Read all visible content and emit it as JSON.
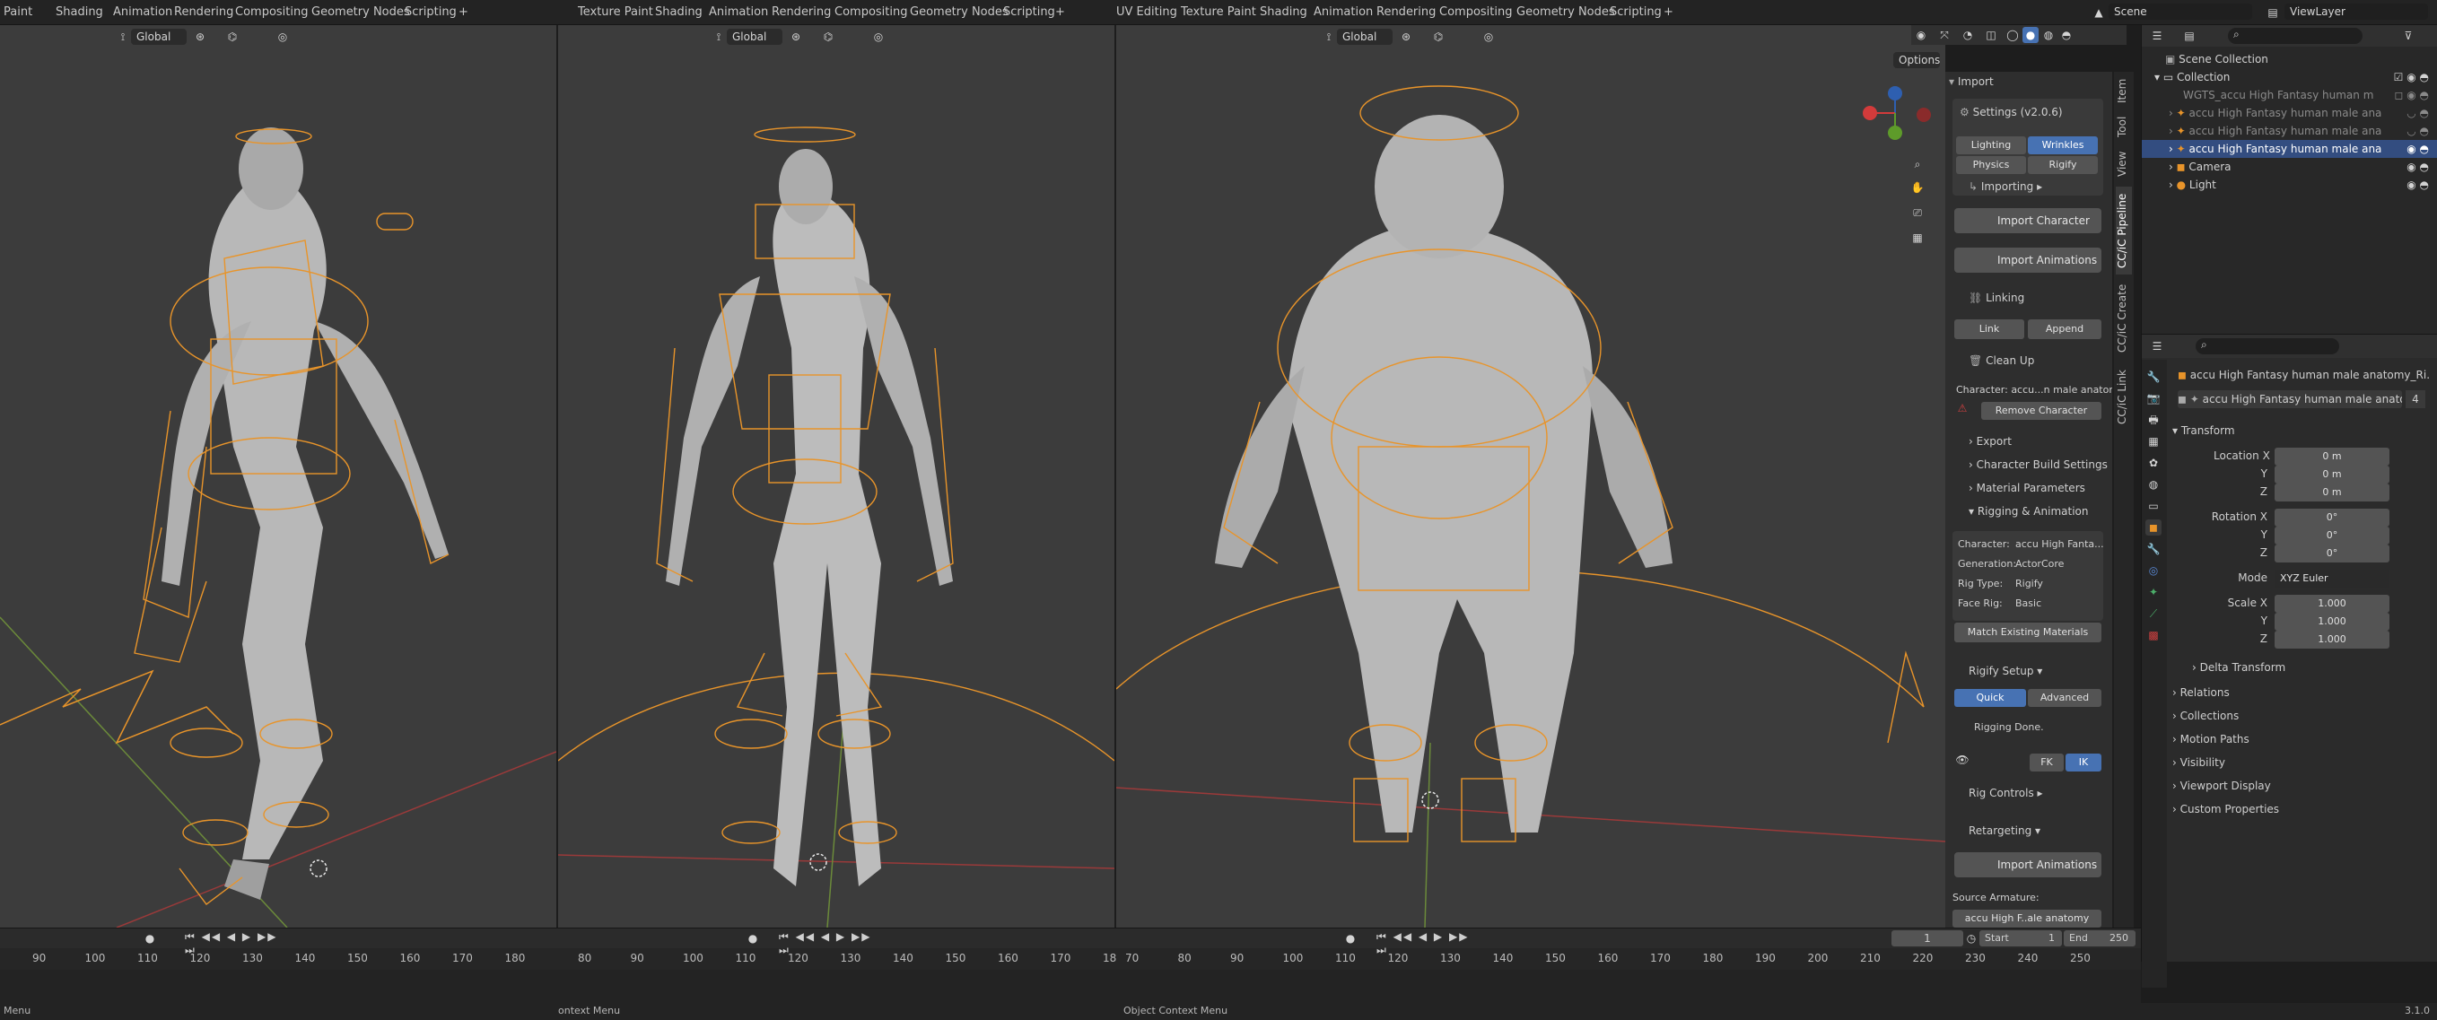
{
  "topbar": {
    "left_tabs": [
      "Paint",
      "Shading",
      "Animation",
      "Rendering",
      "Compositing",
      "Geometry Nodes",
      "Scripting"
    ],
    "middle_tabs": [
      "Texture Paint",
      "Shading",
      "Animation",
      "Rendering",
      "Compositing",
      "Geometry Nodes",
      "Scripting"
    ],
    "right_tabs": [
      "UV Editing",
      "Texture Paint",
      "Shading",
      "Animation",
      "Rendering",
      "Compositing",
      "Geometry Nodes",
      "Scripting"
    ],
    "add_symbol": "+",
    "scene": "Scene",
    "view_layer": "ViewLayer"
  },
  "viewports": {
    "orientation": "Global",
    "options": "Options"
  },
  "npanel": {
    "import_header": "Import",
    "settings": "Settings (v2.0.6)",
    "tabs_row1": [
      "Lighting",
      "Wrinkles"
    ],
    "tabs_row2": [
      "Physics",
      "Rigify"
    ],
    "importing": "Importing",
    "import_character": "Import Character",
    "import_animations": "Import Animations",
    "linking": "Linking",
    "link": "Link",
    "append": "Append",
    "clean_up": "Clean Up",
    "character_label": "Character: accu...n male anatom",
    "remove_character": "Remove Character",
    "export": "Export",
    "character_build": "Character Build Settings",
    "material_params": "Material Parameters",
    "rigging_animation": "Rigging & Animation",
    "info": {
      "character_k": "Character:",
      "character_v": "accu High Fanta...",
      "generation_k": "Generation:",
      "generation_v": "ActorCore",
      "rigtype_k": "Rig Type:",
      "rigtype_v": "Rigify",
      "facerig_k": "Face Rig:",
      "facerig_v": "Basic"
    },
    "match_materials": "Match Existing Materials",
    "rigify_setup": "Rigify Setup",
    "quick": "Quick",
    "advanced": "Advanced",
    "rigging_done": "Rigging Done.",
    "fk": "FK",
    "ik": "IK",
    "rig_controls": "Rig Controls",
    "retargeting": "Retargeting",
    "import_animations2": "Import Animations",
    "source_armature": "Source Armature:",
    "source_value": "accu High F..ale anatomy"
  },
  "vtabs": [
    "Item",
    "Tool",
    "View",
    "CC/iC Pipeline",
    "CC/iC Create",
    "CC/iC Link"
  ],
  "outliner": {
    "rows": [
      {
        "label": "Scene Collection",
        "indent": 0
      },
      {
        "label": "Collection",
        "indent": 1
      },
      {
        "label": "WGTS_accu High Fantasy human m",
        "indent": 2
      },
      {
        "label": "accu High Fantasy human male ana",
        "indent": 2
      },
      {
        "label": "accu High Fantasy human male ana",
        "indent": 2
      },
      {
        "label": "accu High Fantasy human male ana",
        "indent": 2
      },
      {
        "label": "Camera",
        "indent": 2
      },
      {
        "label": "Light",
        "indent": 2
      }
    ]
  },
  "properties": {
    "object_name": "accu High Fantasy human male anatomy_Ri...",
    "data_name": "accu High Fantasy human male anatomy_...",
    "data_users": "4",
    "transform": "Transform",
    "location_x_label": "Location X",
    "location_x": "0 m",
    "y_label": "Y",
    "location_y": "0 m",
    "z_label": "Z",
    "location_z": "0 m",
    "rotation_x_label": "Rotation X",
    "rotation_x": "0°",
    "rotation_y": "0°",
    "rotation_z": "0°",
    "mode_label": "Mode",
    "mode": "XYZ Euler",
    "scale_x_label": "Scale X",
    "scale_x": "1.000",
    "scale_y": "1.000",
    "scale_z": "1.000",
    "delta": "Delta Transform",
    "sections": [
      "Relations",
      "Collections",
      "Motion Paths",
      "Visibility",
      "Viewport Display",
      "Custom Properties"
    ]
  },
  "timeline": {
    "numbers_left": [
      "90",
      "100",
      "110",
      "120",
      "130",
      "140",
      "150",
      "160",
      "170",
      "180"
    ],
    "numbers_mid": [
      "80",
      "90",
      "100",
      "110",
      "120",
      "130",
      "140",
      "150",
      "160",
      "170",
      "18"
    ],
    "numbers_right": [
      "70",
      "80",
      "90",
      "100",
      "110",
      "120",
      "130",
      "140",
      "150",
      "160",
      "170",
      "180",
      "190",
      "200",
      "210",
      "220",
      "230",
      "240",
      "250"
    ],
    "current_frame": "1",
    "start_label": "Start",
    "start": "1",
    "end_label": "End",
    "end": "250"
  },
  "status": {
    "left": "Menu",
    "mid": "ontext Menu",
    "right": "Object Context Menu",
    "version": "3.1.0"
  },
  "colors": {
    "viewport_bg": "#3c3c3c",
    "rig_orange": "#e8942a",
    "accent_blue": "#4772b3"
  }
}
